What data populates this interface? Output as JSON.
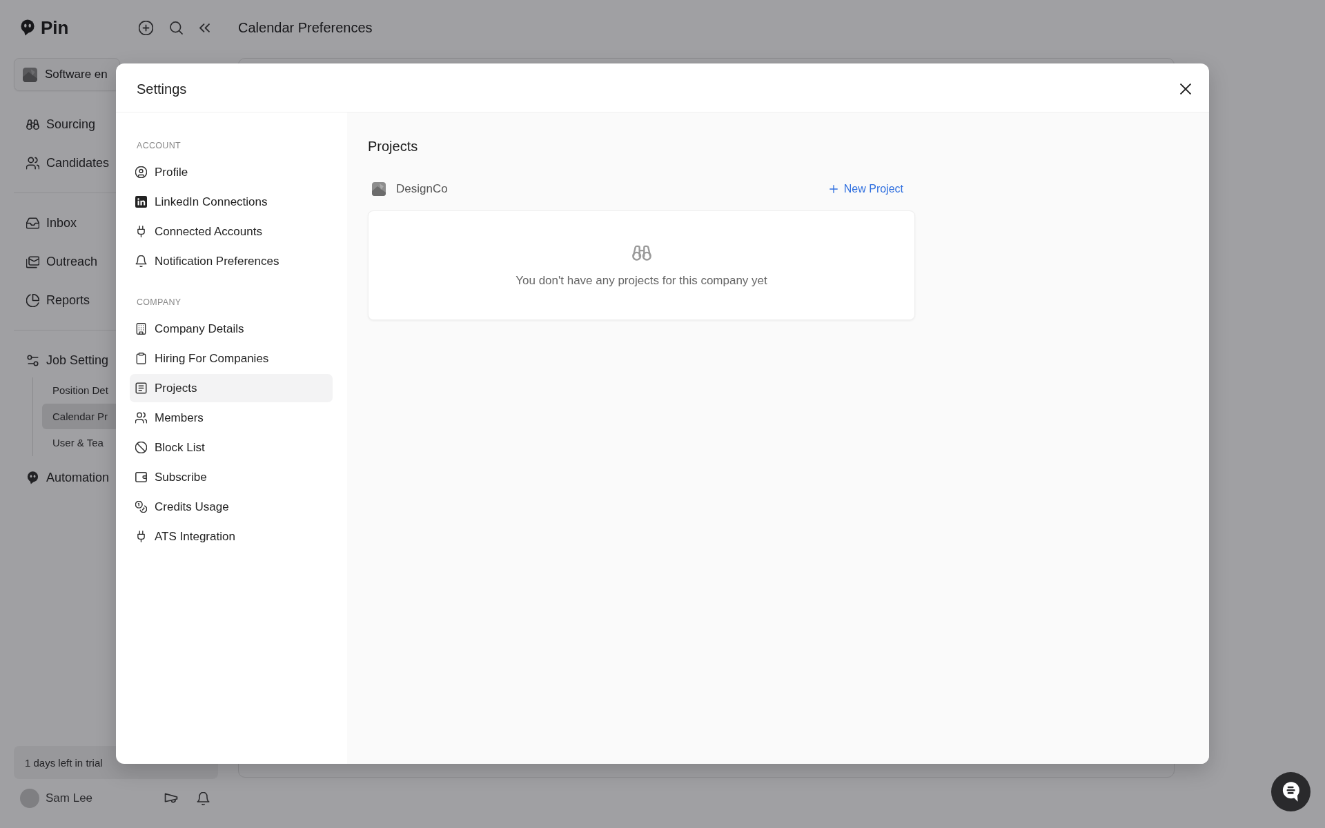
{
  "sidebar": {
    "logo": "Pin",
    "workspace": {
      "name": "Software en"
    },
    "nav_sections": [
      {
        "items": [
          {
            "label": "Sourcing",
            "selected": false
          },
          {
            "label": "Candidates",
            "selected": false
          }
        ]
      },
      {
        "items": [
          {
            "label": "Inbox",
            "selected": false
          },
          {
            "label": "Outreach",
            "selected": false
          },
          {
            "label": "Reports",
            "selected": false
          }
        ]
      },
      {
        "items": [
          {
            "label": "Job Setting",
            "selected": false,
            "children": [
              {
                "label": "Position Det",
                "selected": false
              },
              {
                "label": "Calendar Pr",
                "selected": true
              },
              {
                "label": "User & Tea",
                "selected": false
              }
            ]
          },
          {
            "label": "Automation",
            "selected": false
          }
        ]
      }
    ],
    "trial": {
      "text": "1 days left in trial"
    },
    "user": {
      "name": "Sam Lee"
    }
  },
  "page": {
    "title": "Calendar Preferences"
  },
  "modal": {
    "title": "Settings",
    "nav_sections": [
      {
        "heading": "ACCOUNT",
        "items": [
          {
            "label": "Profile",
            "selected": false
          },
          {
            "label": "LinkedIn Connections",
            "selected": false
          },
          {
            "label": "Connected Accounts",
            "selected": false
          },
          {
            "label": "Notification Preferences",
            "selected": false
          }
        ]
      },
      {
        "heading": "COMPANY",
        "items": [
          {
            "label": "Company Details",
            "selected": false
          },
          {
            "label": "Hiring For Companies",
            "selected": false
          },
          {
            "label": "Projects",
            "selected": true
          },
          {
            "label": "Members",
            "selected": false
          },
          {
            "label": "Block List",
            "selected": false
          },
          {
            "label": "Subscribe",
            "selected": false
          },
          {
            "label": "Credits Usage",
            "selected": false
          },
          {
            "label": "ATS Integration",
            "selected": false
          }
        ]
      }
    ],
    "content": {
      "heading": "Projects",
      "company": "DesignCo",
      "new_project": "New Project",
      "empty_message": "You don't have any projects for this company yet"
    }
  }
}
